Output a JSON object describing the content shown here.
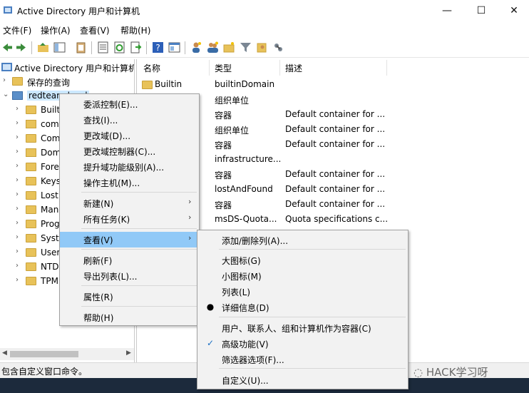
{
  "window": {
    "title": "Active Directory 用户和计算机",
    "minimize_glyph": "—",
    "maximize_glyph": "☐",
    "close_glyph": "✕"
  },
  "menu": [
    "文件(F)",
    "操作(A)",
    "查看(V)",
    "帮助(H)"
  ],
  "toolbar": {
    "icons": [
      "back-icon",
      "forward-icon",
      "up-folder-icon",
      "console-tree-icon",
      "clipboard-icon",
      "properties-icon",
      "refresh-icon",
      "export-icon",
      "help-icon",
      "console-icon",
      "new-user-icon",
      "new-group-icon",
      "new-ou-icon",
      "filter-icon",
      "add-to-group-icon",
      "delegate-icon"
    ]
  },
  "tree": {
    "root": "Active Directory 用户和计算机",
    "saved_queries": "保存的查询",
    "domain": "redteam.local",
    "children": [
      "Built",
      "com",
      "Com",
      "Dom",
      "Fore",
      "Keys",
      "Lost",
      "Man",
      "Prog",
      "Syste",
      "User",
      "NTD",
      "TPM"
    ]
  },
  "list": {
    "headers": [
      "名称",
      "类型",
      "描述"
    ],
    "rows": [
      {
        "name": "Builtin",
        "type": "builtinDomain",
        "desc": ""
      },
      {
        "name": "",
        "type": "组织单位",
        "desc": ""
      },
      {
        "name": "",
        "type": "容器",
        "desc": "Default container for ..."
      },
      {
        "name": "",
        "type": "组织单位",
        "desc": "Default container for ..."
      },
      {
        "name": "",
        "type": "容器",
        "desc": "Default container for ..."
      },
      {
        "name": "",
        "type": "infrastructure...",
        "desc": ""
      },
      {
        "name": "",
        "type": "容器",
        "desc": "Default container for ..."
      },
      {
        "name": "",
        "type": "lostAndFound",
        "desc": "Default container for ..."
      },
      {
        "name": "",
        "type": "容器",
        "desc": "Default container for ..."
      },
      {
        "name": "",
        "type": "msDS-Quota...",
        "desc": "Quota specifications c..."
      }
    ]
  },
  "context_menu": {
    "items": [
      "委派控制(E)...",
      "查找(I)...",
      "更改域(D)...",
      "更改域控制器(C)...",
      "提升域功能级别(A)...",
      "操作主机(M)...",
      "新建(N)",
      "所有任务(K)",
      "查看(V)",
      "刷新(F)",
      "导出列表(L)...",
      "属性(R)",
      "帮助(H)"
    ]
  },
  "submenu": {
    "items": [
      "添加/删除列(A)...",
      "大图标(G)",
      "小图标(M)",
      "列表(L)",
      "详细信息(D)",
      "用户、联系人、组和计算机作为容器(C)",
      "高级功能(V)",
      "筛选器选项(F)...",
      "自定义(U)..."
    ],
    "bullet": "●",
    "check": "✓"
  },
  "status": "包含自定义窗口命令。",
  "watermark": "HACK学习呀",
  "colors": {
    "highlight": "#91c9f7",
    "folder": "#e8c259",
    "taskbar": "#1c2a3c"
  }
}
